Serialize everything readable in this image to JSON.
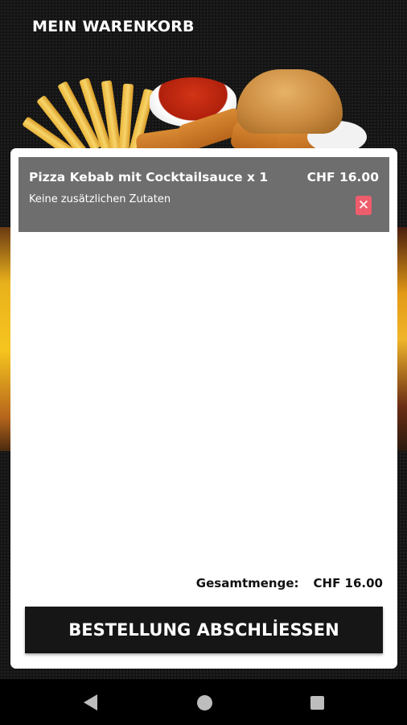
{
  "header": {
    "title": "MEIN WARENKORB"
  },
  "cart": {
    "items": [
      {
        "title": "Pizza Kebab mit Cocktailsauce x 1",
        "price": "CHF 16.00",
        "extras": "Keine zusätzlichen Zutaten",
        "remove_icon": "close-icon"
      }
    ],
    "total_label": "Gesamtmenge:",
    "total_value": "CHF 16.00",
    "checkout_label": "BESTELLUNG ABSCHLİESSEN"
  },
  "nav_bar": {
    "buttons": [
      "back-icon",
      "home-icon",
      "recents-icon"
    ]
  },
  "colors": {
    "remove_button": "#ee5d6c",
    "item_background": "#6e6e6e",
    "checkout_background": "#161616"
  }
}
